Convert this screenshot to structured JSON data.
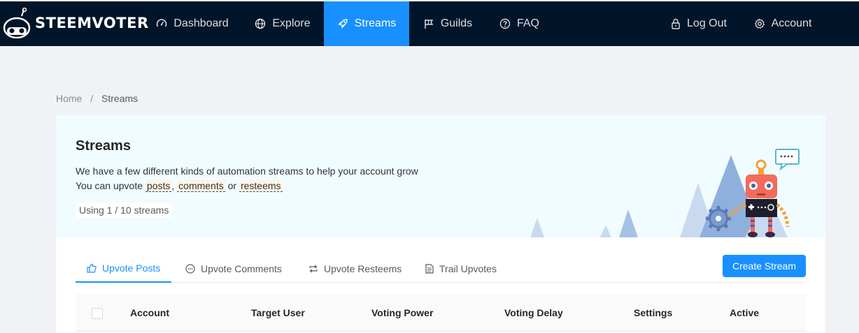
{
  "brand": {
    "name": "STEEMVOTER"
  },
  "nav": {
    "items": [
      {
        "label": "Dashboard",
        "icon": "dashboard-icon"
      },
      {
        "label": "Explore",
        "icon": "globe-icon"
      },
      {
        "label": "Streams",
        "icon": "rocket-icon",
        "active": true
      },
      {
        "label": "Guilds",
        "icon": "flag-icon"
      },
      {
        "label": "FAQ",
        "icon": "question-circle-icon"
      }
    ],
    "right": [
      {
        "label": "Log Out",
        "icon": "lock-icon"
      },
      {
        "label": "Account",
        "icon": "gear-icon"
      }
    ]
  },
  "breadcrumb": {
    "home": "Home",
    "separator": "/",
    "current": "Streams"
  },
  "banner": {
    "title": "Streams",
    "line1": "We have a few different kinds of automation streams to help your account grow",
    "line2_prefix": "You can upvote",
    "link_posts": "posts",
    "comma": ",",
    "link_comments": "comments",
    "or": "or",
    "link_resteems": "resteems",
    "usage": "Using 1 / 10 streams"
  },
  "tabs": [
    {
      "label": "Upvote Posts",
      "icon": "like-icon",
      "active": true
    },
    {
      "label": "Upvote Comments",
      "icon": "message-icon"
    },
    {
      "label": "Upvote Resteems",
      "icon": "retweet-icon"
    },
    {
      "label": "Trail Upvotes",
      "icon": "file-text-icon"
    }
  ],
  "create_button": "Create Stream",
  "table": {
    "columns": [
      "Account",
      "Target User",
      "Voting Power",
      "Voting Delay",
      "Settings",
      "Active"
    ]
  },
  "colors": {
    "primary": "#1890ff",
    "navbar": "#001529",
    "banner_bg": "#f0fcff"
  }
}
